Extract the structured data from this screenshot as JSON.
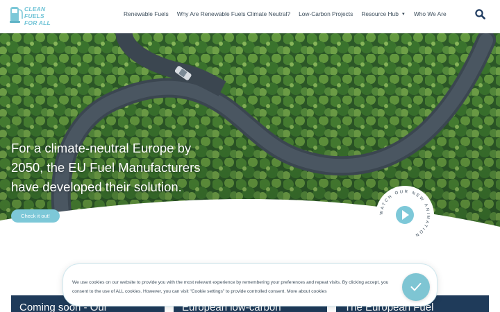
{
  "header": {
    "logo": {
      "line1": "CLEAN FUELS",
      "line2": "FOR ALL"
    },
    "nav": [
      {
        "label": "Renewable Fuels",
        "has_dropdown": false
      },
      {
        "label": "Why Are Renewable Fuels Climate Neutral?",
        "has_dropdown": false
      },
      {
        "label": "Low-Carbon Projects",
        "has_dropdown": false
      },
      {
        "label": "Resource Hub",
        "has_dropdown": true
      },
      {
        "label": "Who We Are",
        "has_dropdown": false
      }
    ],
    "search_icon": "search-icon"
  },
  "hero": {
    "title": "For a climate-neutral Europe by 2050, the EU Fuel Manufacturers have developed their solution.",
    "cta_label": "Check it out!",
    "watch_badge": {
      "text": "WATCH OUR NEW ANIMATION",
      "icon": "play-icon"
    }
  },
  "cards": [
    {
      "title": "Coming soon - Our"
    },
    {
      "title": "European low-carbon"
    },
    {
      "title": "The European Fuel"
    }
  ],
  "cookie": {
    "text": "We use cookies on our website to provide you with the most relevant experience by remembering your preferences and repeat visits. By clicking accept, you consent to the use of ALL cookies. However, you can visit \"Cookie settings\" to provide controlled consent.",
    "more_link": "More about cookies",
    "accept_icon": "checkmark-icon"
  },
  "colors": {
    "accent": "#7dc8d8",
    "nav_text": "#3d4e5c",
    "card_bg": "#1f3b5a",
    "search": "#1e3a5f"
  }
}
